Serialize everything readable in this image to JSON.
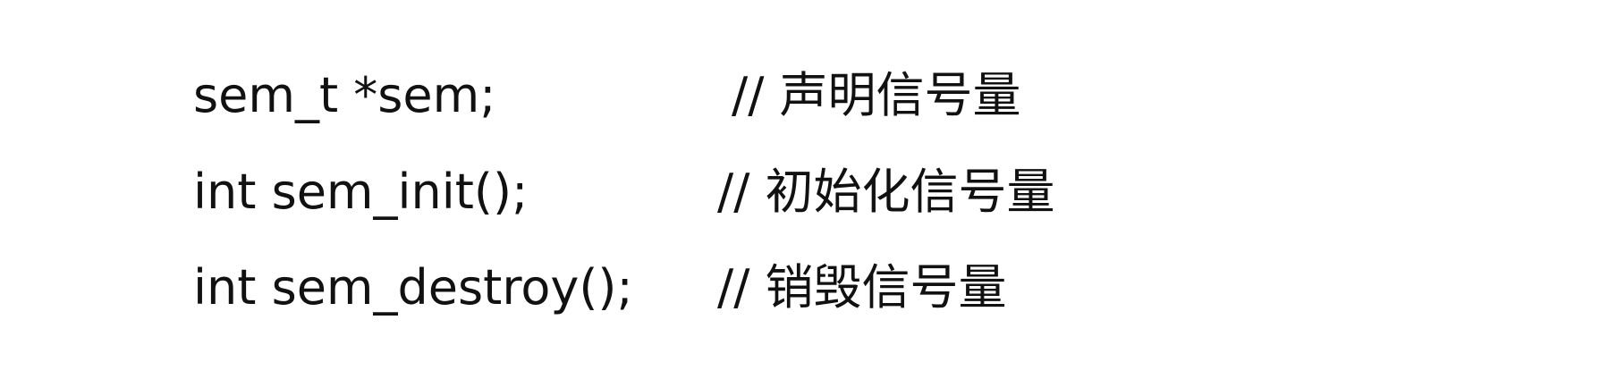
{
  "lines": [
    {
      "code": "sem_t *sem;",
      "comment": "// 声明信号量"
    },
    {
      "code": "int sem_init();",
      "comment": "// 初始化信号量"
    },
    {
      "code": "int sem_destroy();",
      "comment": "// 销毁信号量"
    }
  ]
}
